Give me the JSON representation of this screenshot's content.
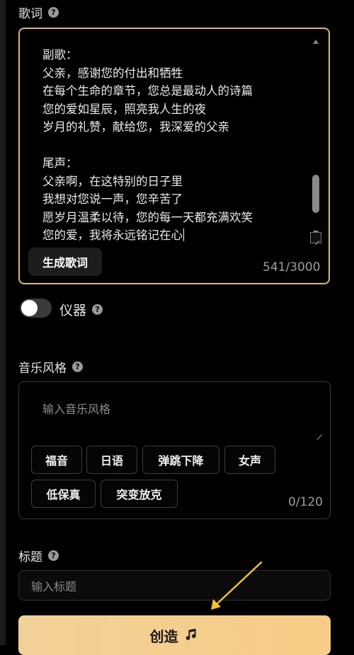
{
  "lyrics_section": {
    "label": "歌词",
    "text": "副歌：\n父亲，感谢您的付出和牺牲\n在每个生命的章节，您总是最动人的诗篇\n您的爱如星辰，照亮我人生的夜\n岁月的礼赞，献给您，我深爱的父亲\n\n尾声：\n父亲啊，在这特别的日子里\n我想对您说一声，您辛苦了\n愿岁月温柔以待，您的每一天都充满欢笑\n您的爱，我将永远铭记在心",
    "generate_button": "生成歌词",
    "char_count": "541/3000"
  },
  "instrument": {
    "label": "仪器",
    "enabled": false
  },
  "style_section": {
    "label": "音乐风格",
    "placeholder": "输入音乐风格",
    "tags": [
      "福音",
      "日语",
      "弹跳下降",
      "女声",
      "低保真",
      "突变放克"
    ],
    "char_count": "0/120"
  },
  "title_section": {
    "label": "标题",
    "placeholder": "输入标题"
  },
  "create_button": {
    "label": "创造"
  },
  "icons": {
    "help": "question-circle-icon",
    "music": "music-note-icon"
  },
  "colors": {
    "accent": "#d8b87a",
    "button_gradient_start": "#f1d199",
    "button_gradient_end": "#f7cc85",
    "arrow": "#f2c230"
  }
}
